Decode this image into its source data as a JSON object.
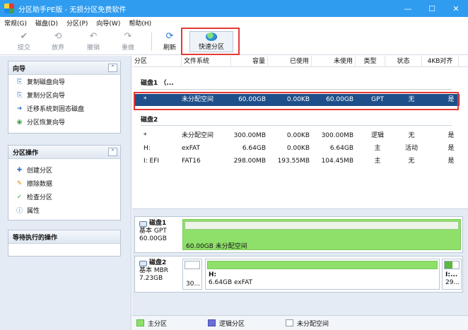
{
  "window": {
    "title": "分区助手PE版 - 无损分区免费软件",
    "minimize": "—",
    "maximize": "☐",
    "close": "✕"
  },
  "menu": [
    "常规(G)",
    "磁盘(D)",
    "分区(P)",
    "向导(W)",
    "帮助(H)"
  ],
  "toolbar": {
    "commit": "提交",
    "discard": "放弃",
    "undo": "撤销",
    "redo": "重做",
    "refresh": "刷新",
    "quick_partition": "快速分区"
  },
  "sidebar": {
    "wizard": {
      "title": "向导",
      "items": [
        "复制磁盘向导",
        "复制分区向导",
        "迁移系统到固态磁盘",
        "分区恢复向导"
      ]
    },
    "partition_ops": {
      "title": "分区操作",
      "items": [
        "创建分区",
        "擦除数据",
        "检查分区",
        "属性"
      ]
    },
    "pending": {
      "title": "等待执行的操作"
    }
  },
  "table": {
    "columns": [
      "分区",
      "文件系统",
      "容量",
      "已使用",
      "未使用",
      "类型",
      "状态",
      "4KB对齐"
    ],
    "disk1": {
      "label": "磁盘1 （...",
      "rows": [
        [
          "*",
          "未分配空间",
          "60.00GB",
          "0.00KB",
          "60.00GB",
          "GPT",
          "无",
          "是"
        ]
      ]
    },
    "disk2": {
      "label": "磁盘2",
      "rows": [
        [
          "*",
          "未分配空间",
          "300.00MB",
          "0.00KB",
          "300.00MB",
          "逻辑",
          "无",
          "是"
        ],
        [
          "H:",
          "exFAT",
          "6.64GB",
          "0.00KB",
          "6.64GB",
          "主",
          "活动",
          "是"
        ],
        [
          "I: EFI",
          "FAT16",
          "298.00MB",
          "193.55MB",
          "104.45MB",
          "主",
          "无",
          "是"
        ]
      ]
    }
  },
  "diskmap": {
    "disk1": {
      "name": "磁盘1",
      "type": "基本 GPT",
      "size": "60.00GB",
      "segments": [
        {
          "label": "60.00GB 未分配空间"
        }
      ]
    },
    "disk2": {
      "name": "磁盘2",
      "type": "基本 MBR",
      "size": "7.23GB",
      "segments": [
        {
          "t2": "30..."
        },
        {
          "t1": "H:",
          "t2": "6.64GB exFAT"
        },
        {
          "t1": "I:...",
          "t2": "29..."
        }
      ]
    }
  },
  "legend": [
    "主分区",
    "逻辑分区",
    "未分配空间"
  ],
  "colors": {
    "titlebar": "#2f9cf0",
    "selection": "#1e4f8a",
    "primary": "#8fe06a",
    "logical": "#6a6fd6",
    "unallocated": "#ffffff",
    "highlight": "#e53935"
  }
}
